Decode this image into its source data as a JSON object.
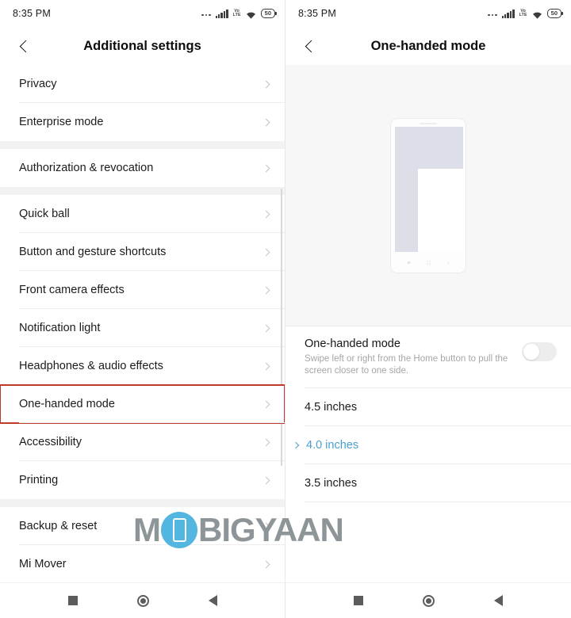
{
  "status_bar": {
    "time": "8:35 PM",
    "network_label": "VoLTE",
    "battery_level": "50",
    "icons": [
      "more-dots-icon",
      "signal-bars-icon",
      "volte-icon",
      "wifi-icon",
      "battery-icon"
    ]
  },
  "left_screen": {
    "title": "Additional settings",
    "back_label": "Back",
    "groups": [
      {
        "items": [
          {
            "label": "Privacy",
            "highlighted": false
          },
          {
            "label": "Enterprise mode",
            "highlighted": false
          }
        ]
      },
      {
        "items": [
          {
            "label": "Authorization & revocation",
            "highlighted": false
          }
        ]
      },
      {
        "items": [
          {
            "label": "Quick ball",
            "highlighted": false
          },
          {
            "label": "Button and gesture shortcuts",
            "highlighted": false
          },
          {
            "label": "Front camera effects",
            "highlighted": false
          },
          {
            "label": "Notification light",
            "highlighted": false
          },
          {
            "label": "Headphones & audio effects",
            "highlighted": false
          },
          {
            "label": "One-handed mode",
            "highlighted": true
          },
          {
            "label": "Accessibility",
            "highlighted": false
          },
          {
            "label": "Printing",
            "highlighted": false
          }
        ]
      },
      {
        "items": [
          {
            "label": "Backup & reset",
            "highlighted": false
          },
          {
            "label": "Mi Mover",
            "highlighted": false
          }
        ]
      }
    ],
    "highlight_color": "#c0392b"
  },
  "right_screen": {
    "title": "One-handed mode",
    "back_label": "Back",
    "illustration": {
      "name": "phone-one-handed-illustration",
      "nav_glyphs": [
        "≡",
        "□",
        "‹"
      ]
    },
    "toggle": {
      "title": "One-handed mode",
      "subtitle": "Swipe left or right from the Home button to pull the screen closer to one side.",
      "state": "off"
    },
    "size_options": [
      {
        "label": "4.5 inches",
        "selected": false
      },
      {
        "label": "4.0 inches",
        "selected": true
      },
      {
        "label": "3.5 inches",
        "selected": false
      }
    ],
    "selected_color": "#4a9ece"
  },
  "nav_bar": {
    "recents_label": "Recents",
    "home_label": "Home",
    "back_label": "Back"
  },
  "watermark": {
    "text_before": "M",
    "text_after": "BIGYAAN",
    "accent_color": "#52b6e0",
    "text_color": "#8d9599"
  }
}
